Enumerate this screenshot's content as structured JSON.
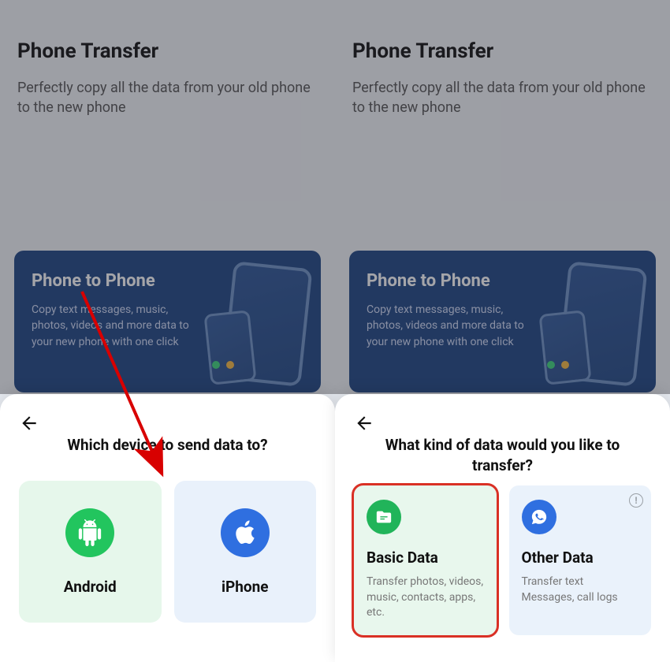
{
  "left": {
    "page_title": "Phone Transfer",
    "page_subtitle": "Perfectly copy all the data from your old phone to the new phone",
    "card": {
      "title": "Phone to Phone",
      "desc": "Copy text messages, music, photos, videos and more data to your new phone with one click"
    },
    "sheet": {
      "title": "Which device to send data to?",
      "options": {
        "android": "Android",
        "iphone": "iPhone"
      }
    }
  },
  "right": {
    "page_title": "Phone Transfer",
    "page_subtitle": "Perfectly copy all the data from your old phone to the new phone",
    "card": {
      "title": "Phone to Phone",
      "desc": "Copy text messages, music, photos, videos and more data to your new phone with one click"
    },
    "sheet": {
      "title": "What kind of data would you like to transfer?",
      "basic": {
        "title": "Basic Data",
        "desc": "Transfer photos, videos, music, contacts, apps, etc."
      },
      "other": {
        "title": "Other Data",
        "desc": "Transfer text Messages, call logs"
      }
    }
  },
  "colors": {
    "highlight_border": "#d93025",
    "accent_green": "#22c55e",
    "accent_blue": "#2f6fe0",
    "card_blue": "#1e4683"
  }
}
